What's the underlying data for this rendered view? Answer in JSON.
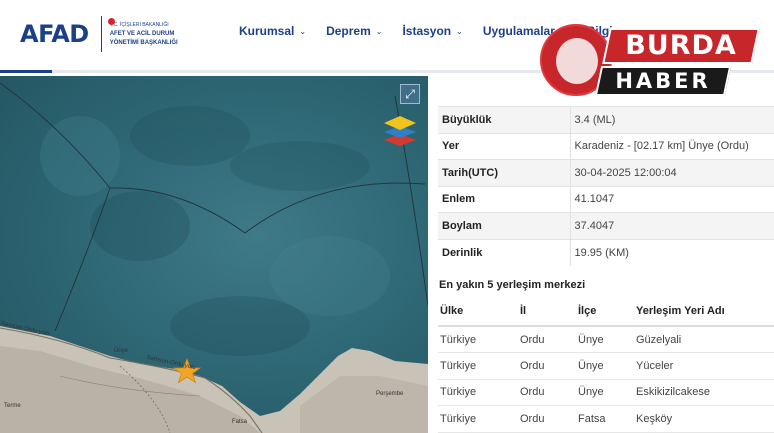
{
  "logo": {
    "brand": "AFAD",
    "line1": "T.C. İÇİŞLERİ BAKANLIĞI",
    "line2": "AFET VE ACİL DURUM",
    "line3": "YÖNETİMİ BAŞKANLIĞI"
  },
  "nav": {
    "items": [
      "Kurumsal",
      "Deprem",
      "İstasyon",
      "Uygulamalar",
      "Bilgi"
    ]
  },
  "watermark": {
    "top": "BURDA",
    "bottom": "HABER"
  },
  "map": {
    "labels": {
      "unye": "Ünye",
      "samsun_ordu_yolu": "Samsun-Ordu yolu",
      "samsun_ordu_yolu_2": "Samsun-Ordu yolu",
      "fatsa": "Fatsa",
      "persembe": "Perşembe",
      "terme": "Terme"
    },
    "marker_color": "#f2a623"
  },
  "details": [
    {
      "key": "Büyüklük",
      "value": "3.4 (ML)"
    },
    {
      "key": "Yer",
      "value": "Karadeniz - [02.17 km] Ünye (Ordu)"
    },
    {
      "key": "Tarih(UTC)",
      "value": "30-04-2025 12:00:04"
    },
    {
      "key": "Enlem",
      "value": "41.1047"
    },
    {
      "key": "Boylam",
      "value": "37.4047"
    },
    {
      "key": "Derinlik",
      "value": "19.95 (KM)"
    }
  ],
  "nearby": {
    "title": "En yakın 5 yerleşim merkezi",
    "headers": [
      "Ülke",
      "İl",
      "İlçe",
      "Yerleşim Yeri Adı"
    ],
    "rows": [
      [
        "Türkiye",
        "Ordu",
        "Ünye",
        "Güzelyali"
      ],
      [
        "Türkiye",
        "Ordu",
        "Ünye",
        "Yüceler"
      ],
      [
        "Türkiye",
        "Ordu",
        "Ünye",
        "Eskikizilcakese"
      ],
      [
        "Türkiye",
        "Ordu",
        "Fatsa",
        "Keşköy"
      ]
    ]
  },
  "colors": {
    "brand": "#1c3f8a",
    "accent_red": "#d22630",
    "sea": "#2f6876"
  }
}
